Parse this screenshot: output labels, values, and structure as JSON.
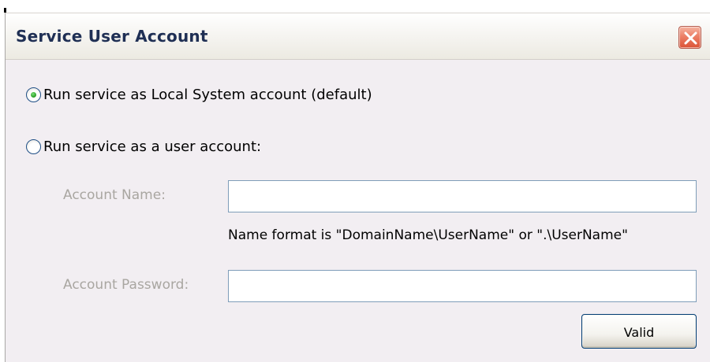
{
  "dialog": {
    "title": "Service User Account",
    "close_icon": "close-x-icon"
  },
  "options": {
    "local_system": {
      "label": "Run service as Local System account (default)",
      "selected": true
    },
    "user_account": {
      "label": "Run service as a user account:",
      "selected": false
    }
  },
  "form": {
    "account_name": {
      "label": "Account Name:",
      "value": "",
      "enabled": false
    },
    "name_hint": "Name format is \"DomainName\\UserName\" or \".\\UserName\"",
    "account_password": {
      "label": "Account Password:",
      "value": "",
      "enabled": false
    },
    "valid_button": "Valid"
  },
  "colors": {
    "title_text": "#1f2f54",
    "close_button": "#e4664a",
    "disabled_label": "#a9a6a1",
    "dialog_background": "#f2eef2",
    "radio_selected_dot": "#2fa52b"
  }
}
